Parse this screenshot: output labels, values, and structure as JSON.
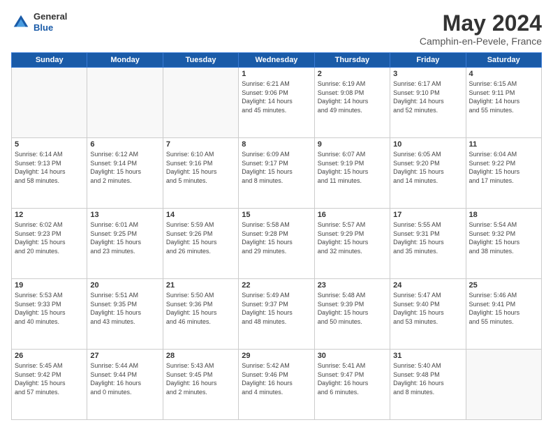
{
  "header": {
    "logo_line1": "General",
    "logo_line2": "Blue",
    "month": "May 2024",
    "location": "Camphin-en-Pevele, France"
  },
  "weekdays": [
    "Sunday",
    "Monday",
    "Tuesday",
    "Wednesday",
    "Thursday",
    "Friday",
    "Saturday"
  ],
  "weeks": [
    [
      {
        "day": "",
        "info": ""
      },
      {
        "day": "",
        "info": ""
      },
      {
        "day": "",
        "info": ""
      },
      {
        "day": "1",
        "info": "Sunrise: 6:21 AM\nSunset: 9:06 PM\nDaylight: 14 hours\nand 45 minutes."
      },
      {
        "day": "2",
        "info": "Sunrise: 6:19 AM\nSunset: 9:08 PM\nDaylight: 14 hours\nand 49 minutes."
      },
      {
        "day": "3",
        "info": "Sunrise: 6:17 AM\nSunset: 9:10 PM\nDaylight: 14 hours\nand 52 minutes."
      },
      {
        "day": "4",
        "info": "Sunrise: 6:15 AM\nSunset: 9:11 PM\nDaylight: 14 hours\nand 55 minutes."
      }
    ],
    [
      {
        "day": "5",
        "info": "Sunrise: 6:14 AM\nSunset: 9:13 PM\nDaylight: 14 hours\nand 58 minutes."
      },
      {
        "day": "6",
        "info": "Sunrise: 6:12 AM\nSunset: 9:14 PM\nDaylight: 15 hours\nand 2 minutes."
      },
      {
        "day": "7",
        "info": "Sunrise: 6:10 AM\nSunset: 9:16 PM\nDaylight: 15 hours\nand 5 minutes."
      },
      {
        "day": "8",
        "info": "Sunrise: 6:09 AM\nSunset: 9:17 PM\nDaylight: 15 hours\nand 8 minutes."
      },
      {
        "day": "9",
        "info": "Sunrise: 6:07 AM\nSunset: 9:19 PM\nDaylight: 15 hours\nand 11 minutes."
      },
      {
        "day": "10",
        "info": "Sunrise: 6:05 AM\nSunset: 9:20 PM\nDaylight: 15 hours\nand 14 minutes."
      },
      {
        "day": "11",
        "info": "Sunrise: 6:04 AM\nSunset: 9:22 PM\nDaylight: 15 hours\nand 17 minutes."
      }
    ],
    [
      {
        "day": "12",
        "info": "Sunrise: 6:02 AM\nSunset: 9:23 PM\nDaylight: 15 hours\nand 20 minutes."
      },
      {
        "day": "13",
        "info": "Sunrise: 6:01 AM\nSunset: 9:25 PM\nDaylight: 15 hours\nand 23 minutes."
      },
      {
        "day": "14",
        "info": "Sunrise: 5:59 AM\nSunset: 9:26 PM\nDaylight: 15 hours\nand 26 minutes."
      },
      {
        "day": "15",
        "info": "Sunrise: 5:58 AM\nSunset: 9:28 PM\nDaylight: 15 hours\nand 29 minutes."
      },
      {
        "day": "16",
        "info": "Sunrise: 5:57 AM\nSunset: 9:29 PM\nDaylight: 15 hours\nand 32 minutes."
      },
      {
        "day": "17",
        "info": "Sunrise: 5:55 AM\nSunset: 9:31 PM\nDaylight: 15 hours\nand 35 minutes."
      },
      {
        "day": "18",
        "info": "Sunrise: 5:54 AM\nSunset: 9:32 PM\nDaylight: 15 hours\nand 38 minutes."
      }
    ],
    [
      {
        "day": "19",
        "info": "Sunrise: 5:53 AM\nSunset: 9:33 PM\nDaylight: 15 hours\nand 40 minutes."
      },
      {
        "day": "20",
        "info": "Sunrise: 5:51 AM\nSunset: 9:35 PM\nDaylight: 15 hours\nand 43 minutes."
      },
      {
        "day": "21",
        "info": "Sunrise: 5:50 AM\nSunset: 9:36 PM\nDaylight: 15 hours\nand 46 minutes."
      },
      {
        "day": "22",
        "info": "Sunrise: 5:49 AM\nSunset: 9:37 PM\nDaylight: 15 hours\nand 48 minutes."
      },
      {
        "day": "23",
        "info": "Sunrise: 5:48 AM\nSunset: 9:39 PM\nDaylight: 15 hours\nand 50 minutes."
      },
      {
        "day": "24",
        "info": "Sunrise: 5:47 AM\nSunset: 9:40 PM\nDaylight: 15 hours\nand 53 minutes."
      },
      {
        "day": "25",
        "info": "Sunrise: 5:46 AM\nSunset: 9:41 PM\nDaylight: 15 hours\nand 55 minutes."
      }
    ],
    [
      {
        "day": "26",
        "info": "Sunrise: 5:45 AM\nSunset: 9:42 PM\nDaylight: 15 hours\nand 57 minutes."
      },
      {
        "day": "27",
        "info": "Sunrise: 5:44 AM\nSunset: 9:44 PM\nDaylight: 16 hours\nand 0 minutes."
      },
      {
        "day": "28",
        "info": "Sunrise: 5:43 AM\nSunset: 9:45 PM\nDaylight: 16 hours\nand 2 minutes."
      },
      {
        "day": "29",
        "info": "Sunrise: 5:42 AM\nSunset: 9:46 PM\nDaylight: 16 hours\nand 4 minutes."
      },
      {
        "day": "30",
        "info": "Sunrise: 5:41 AM\nSunset: 9:47 PM\nDaylight: 16 hours\nand 6 minutes."
      },
      {
        "day": "31",
        "info": "Sunrise: 5:40 AM\nSunset: 9:48 PM\nDaylight: 16 hours\nand 8 minutes."
      },
      {
        "day": "",
        "info": ""
      }
    ]
  ]
}
